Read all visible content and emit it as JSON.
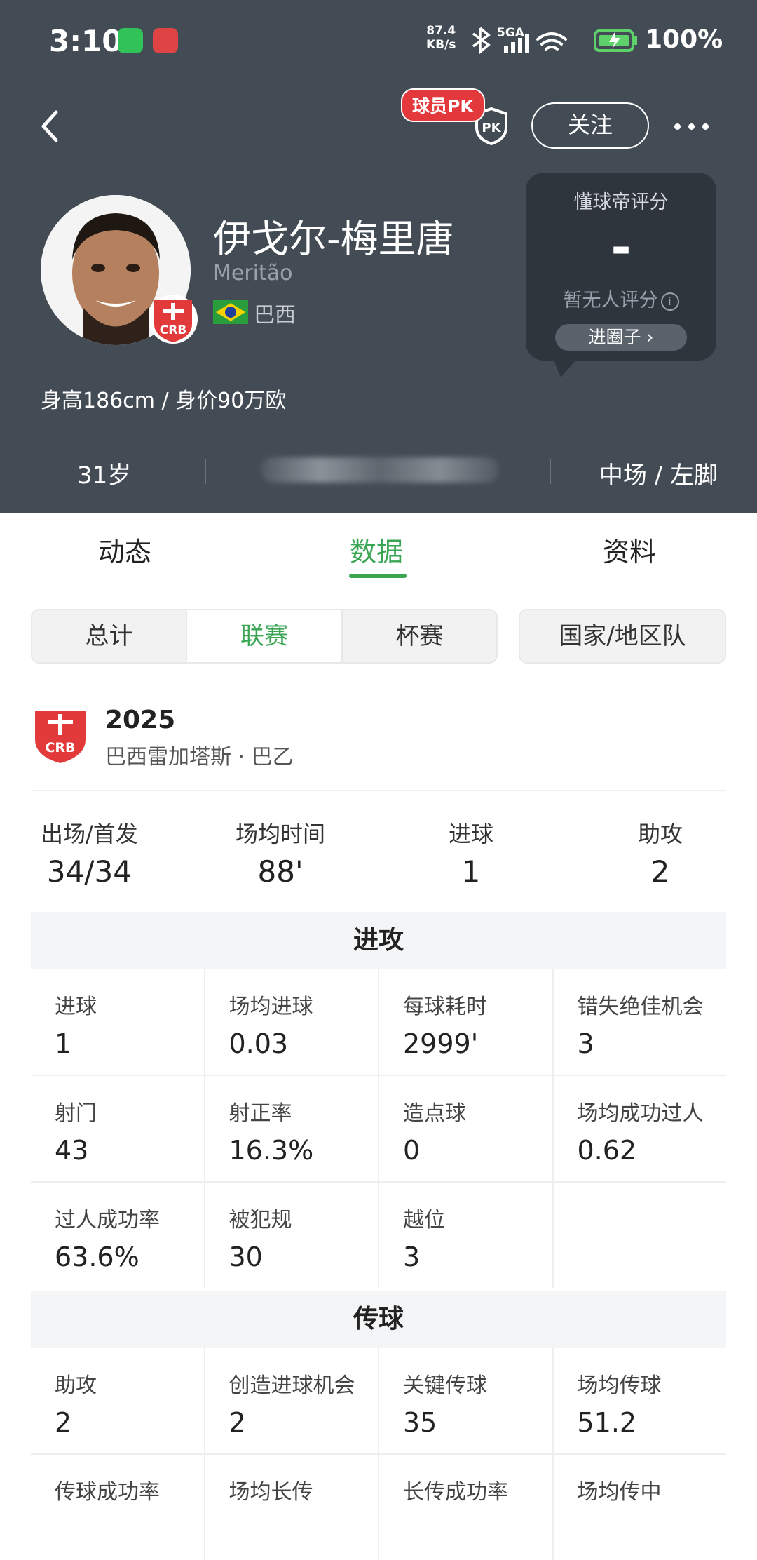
{
  "status_bar": {
    "time": "3:10",
    "net_speed": "87.4",
    "net_unit": "KB/s",
    "signal": "5GA",
    "battery": "100%"
  },
  "header": {
    "pk_label": "球员PK",
    "pk_shield_text": "PK",
    "follow_label": "关注",
    "player_name": "伊戈尔-梅里唐",
    "player_latin": "Meritão",
    "nation": "巴西",
    "club_badge_text": "CRB",
    "body_info": "身高186cm / 身价90万欧",
    "age": "31岁",
    "position": "中场 / 左脚"
  },
  "rating": {
    "title": "懂球帝评分",
    "value": "-",
    "empty_label": "暂无人评分",
    "circle_button": "进圈子"
  },
  "tabs": [
    {
      "label": "动态"
    },
    {
      "label": "数据"
    },
    {
      "label": "资料"
    }
  ],
  "segments": {
    "items": [
      "总计",
      "联赛",
      "杯赛"
    ],
    "national_team": "国家/地区队"
  },
  "league": {
    "season": "2025",
    "name": "巴西雷加塔斯 · 巴乙"
  },
  "summary": [
    {
      "label": "出场/首发",
      "value": "34/34"
    },
    {
      "label": "场均时间",
      "value": "88'"
    },
    {
      "label": "进球",
      "value": "1"
    },
    {
      "label": "助攻",
      "value": "2"
    }
  ],
  "attack": {
    "title": "进攻",
    "cells": [
      {
        "label": "进球",
        "value": "1"
      },
      {
        "label": "场均进球",
        "value": "0.03"
      },
      {
        "label": "每球耗时",
        "value": "2999'"
      },
      {
        "label": "错失绝佳机会",
        "value": "3"
      },
      {
        "label": "射门",
        "value": "43"
      },
      {
        "label": "射正率",
        "value": "16.3%"
      },
      {
        "label": "造点球",
        "value": "0"
      },
      {
        "label": "场均成功过人",
        "value": "0.62"
      },
      {
        "label": "过人成功率",
        "value": "63.6%"
      },
      {
        "label": "被犯规",
        "value": "30"
      },
      {
        "label": "越位",
        "value": "3"
      },
      {
        "label": "",
        "value": ""
      }
    ]
  },
  "passing": {
    "title": "传球",
    "cells": [
      {
        "label": "助攻",
        "value": "2"
      },
      {
        "label": "创造进球机会",
        "value": "2"
      },
      {
        "label": "关键传球",
        "value": "35"
      },
      {
        "label": "场均传球",
        "value": "51.2"
      },
      {
        "label": "传球成功率",
        "value": ""
      },
      {
        "label": "场均长传",
        "value": ""
      },
      {
        "label": "长传成功率",
        "value": ""
      },
      {
        "label": "场均传中",
        "value": ""
      }
    ]
  },
  "colors": {
    "header_bg": "#434b55",
    "accent_green": "#3aa654",
    "pk_red": "#e4393c"
  }
}
